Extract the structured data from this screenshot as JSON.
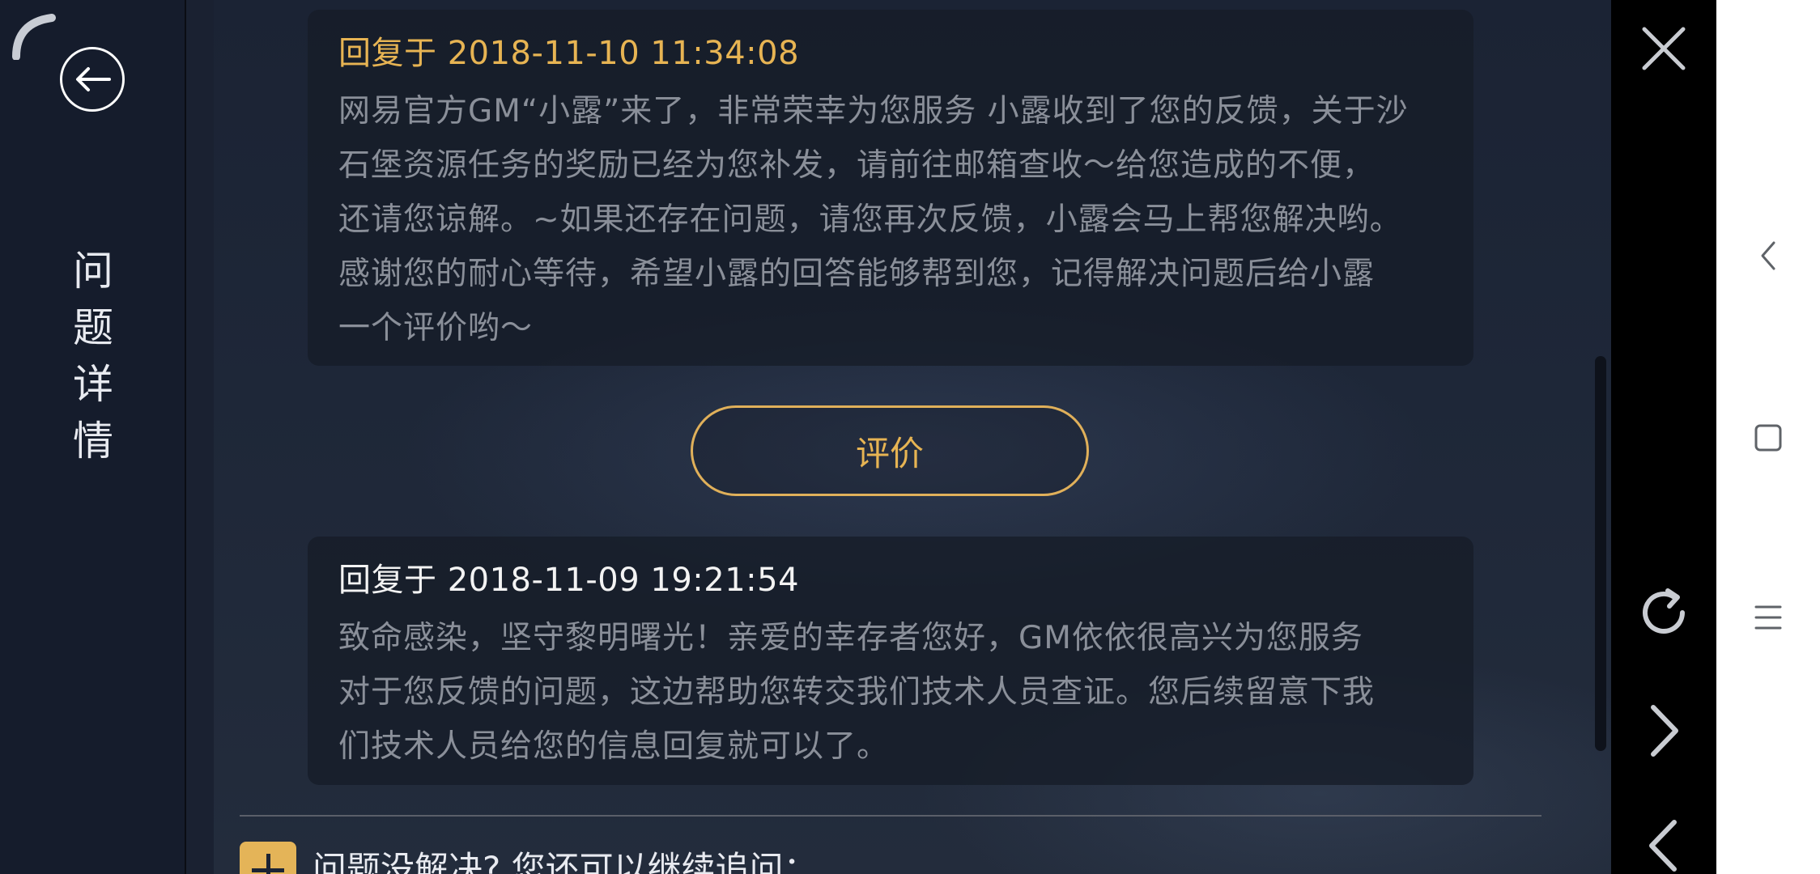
{
  "sidebar": {
    "title_chars": [
      "问",
      "题",
      "详",
      "情"
    ]
  },
  "replies": [
    {
      "title": "回复于 2018-11-10 11:34:08",
      "body": "网易官方GM“小露”来了，非常荣幸为您服务 小露收到了您的反馈，关于沙\n石堡资源任务的奖励已经为您补发，请前往邮箱查收～给您造成的不便，\n还请您谅解。~如果还存在问题，请您再次反馈，小露会马上帮您解决哟。\n感谢您的耐心等待，希望小露的回答能够帮到您，记得解决问题后给小露\n一个评价哟～"
    },
    {
      "title": "回复于 2018-11-09 19:21:54",
      "body": "致命感染，坚守黎明曙光！亲爱的幸存者您好，GM依依很高兴为您服务\n对于您反馈的问题，这边帮助您转交我们技术人员查证。您后续留意下我\n们技术人员给您的信息回复就可以了。"
    }
  ],
  "rate_button": {
    "label": "评价"
  },
  "followup": {
    "label": "问题没解决? 您还可以继续追问："
  },
  "colors": {
    "accent_gold": "#e7b453",
    "panel_bg": "#1e2738",
    "sidebar_bg": "#151c2c",
    "body_text": "#8a8f99"
  },
  "icons": {
    "back": "arrow-left-circle-icon",
    "close": "close-icon",
    "refresh": "refresh-icon",
    "forward": "chevron-right-icon",
    "backward": "chevron-left-icon",
    "nav_back": "nav-back-icon",
    "nav_home": "nav-home-icon",
    "nav_menu": "nav-menu-icon"
  }
}
